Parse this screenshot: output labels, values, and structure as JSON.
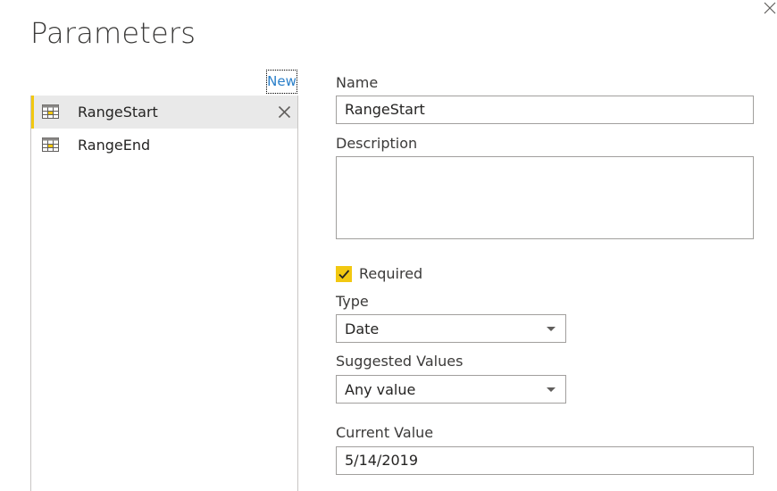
{
  "dialog": {
    "title": "Parameters",
    "new_link": "New"
  },
  "parameters": [
    {
      "name": "RangeStart",
      "selected": true
    },
    {
      "name": "RangeEnd",
      "selected": false
    }
  ],
  "form": {
    "name_label": "Name",
    "name_value": "RangeStart",
    "description_label": "Description",
    "description_value": "",
    "required_label": "Required",
    "required_checked": true,
    "type_label": "Type",
    "type_value": "Date",
    "suggested_label": "Suggested Values",
    "suggested_value": "Any value",
    "current_label": "Current Value",
    "current_value": "5/14/2019"
  },
  "colors": {
    "accent": "#f2c811",
    "link": "#2a7fc9",
    "selected_bg": "#e9e9e9"
  }
}
